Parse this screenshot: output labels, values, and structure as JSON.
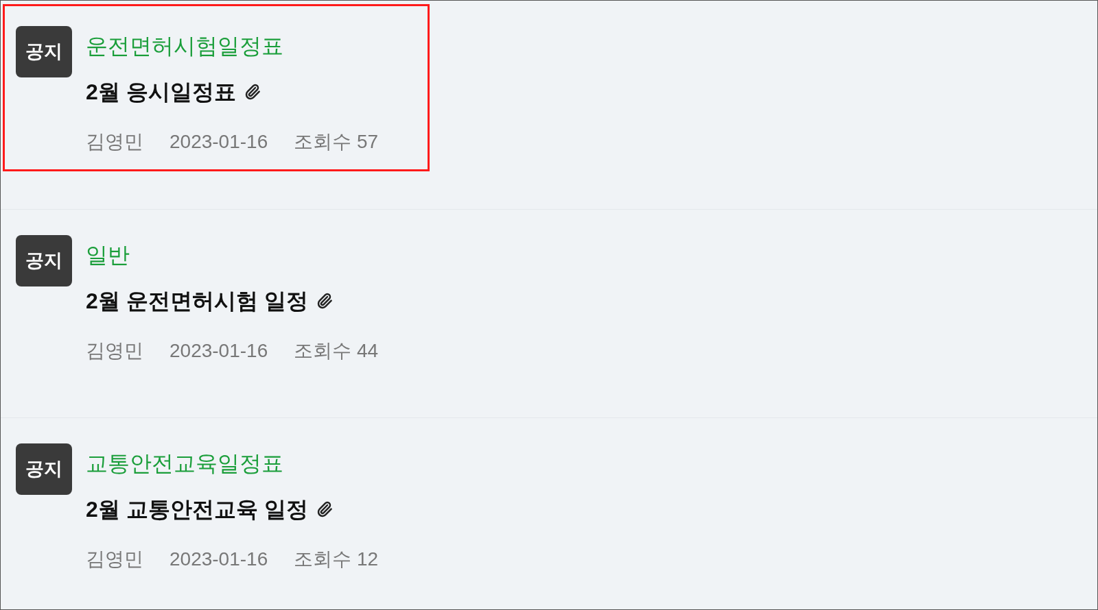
{
  "posts": [
    {
      "badge": "공지",
      "category": "운전면허시험일정표",
      "title": "2월 응시일정표",
      "attachment": true,
      "author": "김영민",
      "date": "2023-01-16",
      "views": "조회수 57",
      "highlighted": true
    },
    {
      "badge": "공지",
      "category": "일반",
      "title": "2월 운전면허시험 일정",
      "attachment": true,
      "author": "김영민",
      "date": "2023-01-16",
      "views": "조회수 44",
      "highlighted": false
    },
    {
      "badge": "공지",
      "category": "교통안전교육일정표",
      "title": "2월 교통안전교육 일정",
      "attachment": true,
      "author": "김영민",
      "date": "2023-01-16",
      "views": "조회수 12",
      "highlighted": false
    }
  ]
}
